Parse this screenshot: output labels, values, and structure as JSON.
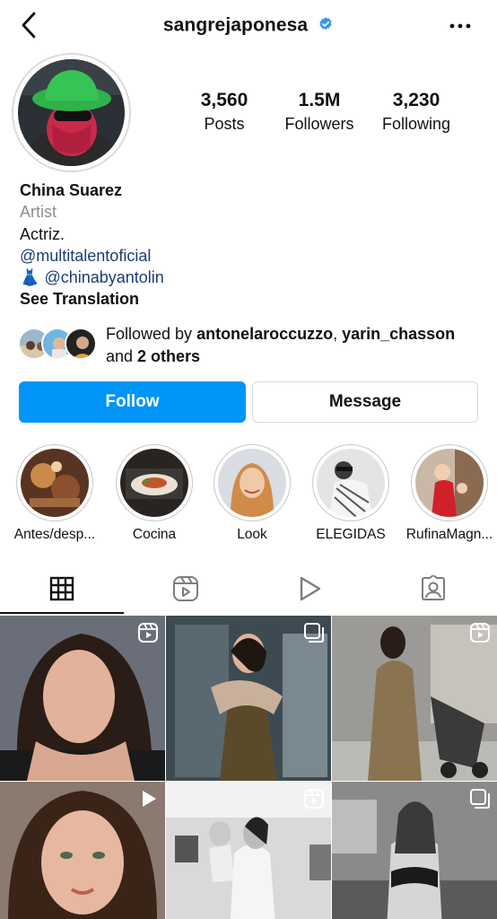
{
  "header": {
    "username": "sangrejaponesa",
    "verified": true
  },
  "stats": {
    "posts_count": "3,560",
    "posts_label": "Posts",
    "followers_count": "1.5M",
    "followers_label": "Followers",
    "following_count": "3,230",
    "following_label": "Following"
  },
  "bio": {
    "name": "China Suarez",
    "category": "Artist",
    "text": "Actriz.",
    "link1": "@multitalentoficial",
    "link2_emoji": "👗",
    "link2": "@chinabyantolin",
    "see_translation": "See Translation"
  },
  "followed_by": {
    "prefix": "Followed by ",
    "user1": "antonelaroccuzzo",
    "sep": ", ",
    "user2": "yarin_chasson",
    "and_text": "and ",
    "others": "2 others"
  },
  "actions": {
    "follow_label": "Follow",
    "message_label": "Message"
  },
  "highlights": [
    {
      "label": "Antes/desp..."
    },
    {
      "label": "Cocina"
    },
    {
      "label": "Look"
    },
    {
      "label": "ELEGIDAS"
    },
    {
      "label": "RufinaMagn..."
    }
  ],
  "tabs": [
    {
      "icon": "grid-icon",
      "active": true
    },
    {
      "icon": "reels-icon",
      "active": false
    },
    {
      "icon": "video-play-icon",
      "active": false
    },
    {
      "icon": "tagged-icon",
      "active": false
    }
  ],
  "colors": {
    "accent": "#0095f6",
    "link": "#1c3d77",
    "muted": "#8e8e8e",
    "border": "#dbdbdb"
  }
}
